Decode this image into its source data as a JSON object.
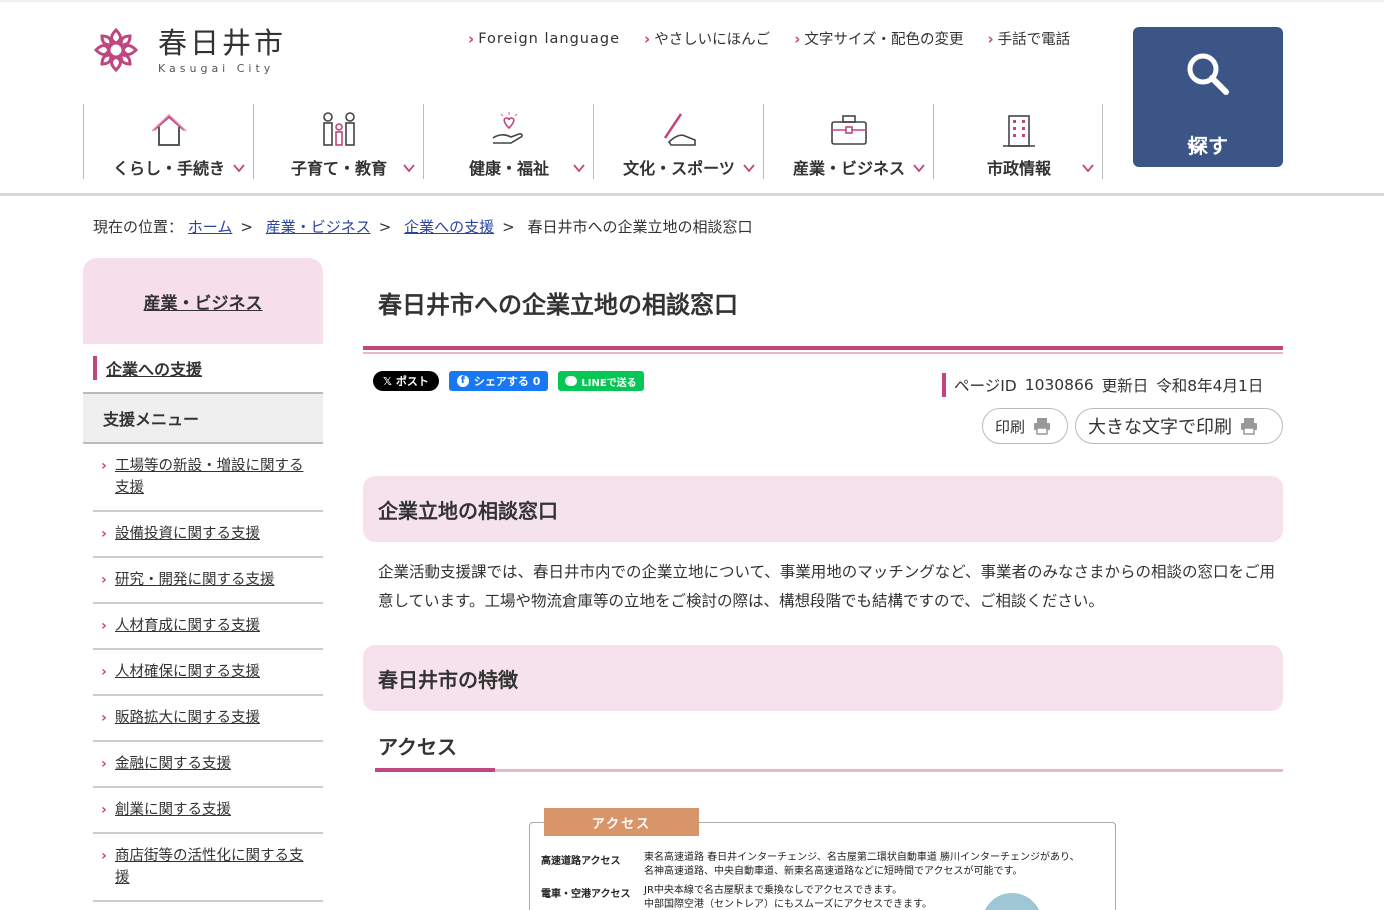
{
  "header": {
    "logo_title": "春日井市",
    "logo_sub": "Kasugai City",
    "util_links": [
      "Foreign language",
      "やさしいにほんご",
      "文字サイズ・配色の変更",
      "手話で電話"
    ],
    "search_label": "探す"
  },
  "gnav": [
    "くらし・手続き",
    "子育て・教育",
    "健康・福祉",
    "文化・スポーツ",
    "産業・ビジネス",
    "市政情報"
  ],
  "breadcrumb": {
    "prefix": "現在の位置：",
    "links": [
      "ホーム",
      "産業・ビジネス",
      "企業への支援"
    ],
    "current": "春日井市への企業立地の相談窓口"
  },
  "sidebar": {
    "category": "産業・ビジネス",
    "current": "企業への支援",
    "menu_title": "支援メニュー",
    "items": [
      "工場等の新設・増設に関する支援",
      "設備投資に関する支援",
      "研究・開発に関する支援",
      "人材育成に関する支援",
      "人材確保に関する支援",
      "販路拡大に関する支援",
      "金融に関する支援",
      "創業に関する支援",
      "商店街等の活性化に関する支援"
    ]
  },
  "main": {
    "title": "春日井市への企業立地の相談窓口",
    "sns": {
      "x": "ポスト",
      "fb": "シェアする 0",
      "line": "LINEで送る"
    },
    "meta": {
      "page_id_label": "ページID",
      "page_id": "1030866",
      "updated_label": "更新日",
      "updated": "令和8年4月1日"
    },
    "print": "印刷",
    "print_large": "大きな文字で印刷",
    "section1_title": "企業立地の相談窓口",
    "section1_body": "企業活動支援課では、春日井市内での企業立地について、事業用地のマッチングなど、事業者のみなさまからの相談の窓口をご用意しています。工場や物流倉庫等の立地をご検討の際は、構想段階でも結構ですので、ご相談ください。",
    "section2_title": "春日井市の特徴",
    "sub_title": "アクセス",
    "access_image": {
      "tag": "アクセス",
      "rows": [
        {
          "label": "高速道路アクセス",
          "text1": "東名高速道路 春日井インターチェンジ、名古屋第二環状自動車道 勝川インターチェンジがあり、",
          "text2": "名神高速道路、中央自動車道、新東名高速道路などに短時間でアクセスが可能です。"
        },
        {
          "label": "電車・空港アクセス",
          "text1": "JR中央本線で名古屋駅まで乗換なしでアクセスできます。",
          "text2": "中部国際空港（セントレア）にもスムーズにアクセスできます。"
        }
      ]
    }
  },
  "colors": {
    "accent": "#c0467f",
    "pink_bg": "#f6e2ed",
    "search_bg": "#3a5586"
  }
}
